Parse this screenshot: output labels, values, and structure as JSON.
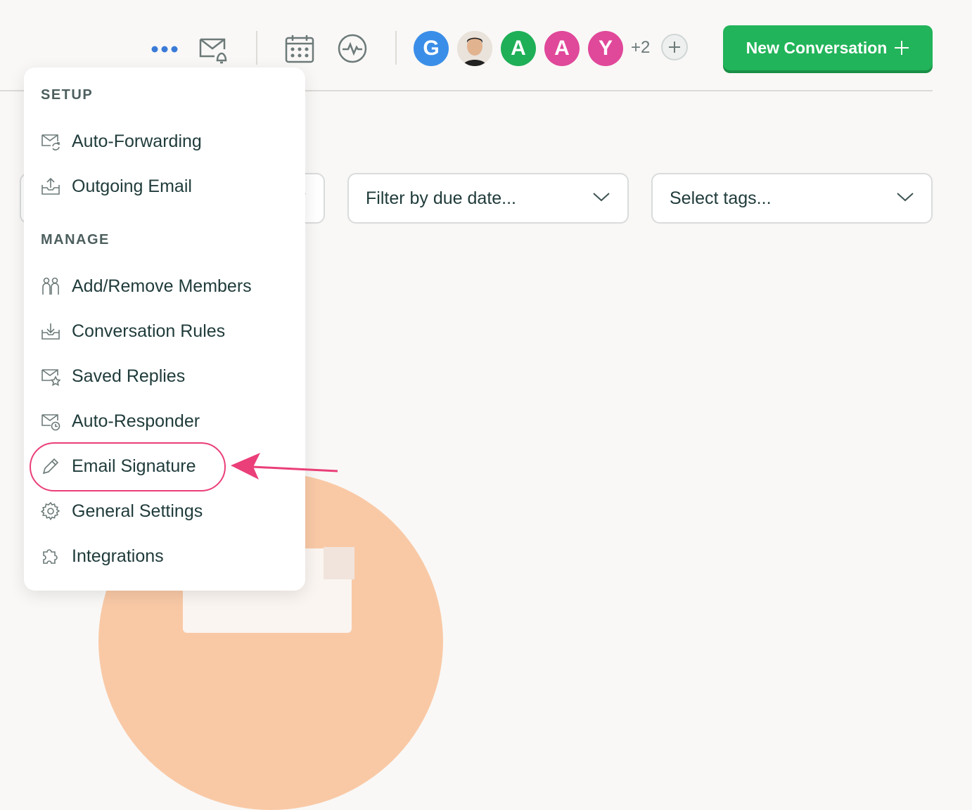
{
  "header": {
    "more_icon": "dots-icon",
    "avatars": [
      {
        "letter": "G",
        "color": "#3b8ee8"
      },
      {
        "letter": "",
        "color": "#8a8a8a",
        "type": "photo"
      },
      {
        "letter": "A",
        "color": "#1faf57"
      },
      {
        "letter": "A",
        "color": "#e0489a"
      },
      {
        "letter": "Y",
        "color": "#e0489a"
      }
    ],
    "extra_count": "+2",
    "new_conversation_label": "New Conversation"
  },
  "filters": {
    "due_date_placeholder": "Filter by due date...",
    "tags_placeholder": "Select tags..."
  },
  "menu": {
    "setup_label": "SETUP",
    "setup_items": [
      {
        "label": "Auto-Forwarding",
        "icon": "mail-forward-icon"
      },
      {
        "label": "Outgoing Email",
        "icon": "outbox-icon"
      }
    ],
    "manage_label": "MANAGE",
    "manage_items": [
      {
        "label": "Add/Remove Members",
        "icon": "members-icon"
      },
      {
        "label": "Conversation Rules",
        "icon": "inbox-rules-icon"
      },
      {
        "label": "Saved Replies",
        "icon": "mail-star-icon"
      },
      {
        "label": "Auto-Responder",
        "icon": "mail-clock-icon"
      },
      {
        "label": "Email Signature",
        "icon": "pencil-icon"
      },
      {
        "label": "General Settings",
        "icon": "gear-icon"
      },
      {
        "label": "Integrations",
        "icon": "puzzle-icon"
      }
    ]
  },
  "colors": {
    "accent_green": "#22b45a",
    "highlight_pink": "#ea3f78"
  }
}
